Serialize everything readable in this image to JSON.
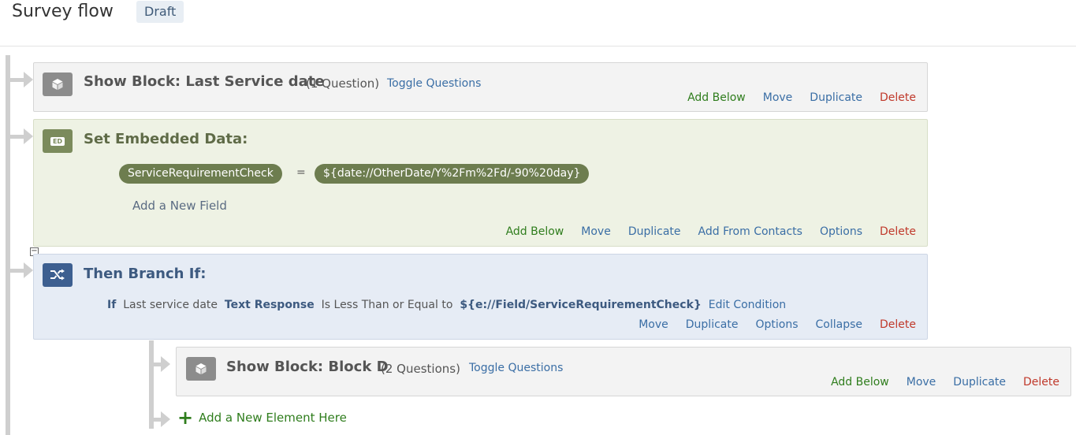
{
  "header": {
    "title": "Survey flow",
    "status_badge": "Draft"
  },
  "blocks": {
    "show_block_1": {
      "title": "Show Block: Last Service date",
      "question_count": "(1 Question)",
      "toggle_label": "Toggle Questions",
      "actions": {
        "add_below": "Add Below",
        "move": "Move",
        "duplicate": "Duplicate",
        "delete": "Delete"
      }
    },
    "embedded_data": {
      "title": "Set Embedded Data:",
      "icon_text": "ED",
      "field_name": "ServiceRequirementCheck",
      "operator": "=",
      "field_value": "${date://OtherDate/Y%2Fm%2Fd/-90%20day}",
      "add_field_label": "Add a New Field",
      "actions": {
        "add_below": "Add Below",
        "move": "Move",
        "duplicate": "Duplicate",
        "add_from_contacts": "Add From Contacts",
        "options": "Options",
        "delete": "Delete"
      }
    },
    "branch": {
      "title": "Then Branch If:",
      "condition": {
        "if_label": "If",
        "question": "Last service date",
        "response_type": "Text Response",
        "operator": "Is Less Than or Equal to",
        "value": "${e://Field/ServiceRequirementCheck}",
        "edit_label": "Edit Condition"
      },
      "actions": {
        "move": "Move",
        "duplicate": "Duplicate",
        "options": "Options",
        "collapse": "Collapse",
        "delete": "Delete"
      }
    },
    "show_block_2": {
      "title": "Show Block: Block D",
      "question_count": "(2 Questions)",
      "toggle_label": "Toggle Questions",
      "actions": {
        "add_below": "Add Below",
        "move": "Move",
        "duplicate": "Duplicate",
        "delete": "Delete"
      }
    }
  },
  "add_element_label": "Add a New Element Here",
  "colors": {
    "add_green": "#2f7d1d",
    "link_blue": "#3a6ea5",
    "delete_red": "#c0392b",
    "embedded_green": "#6d7d4f",
    "branch_blue": "#3d5f90"
  }
}
